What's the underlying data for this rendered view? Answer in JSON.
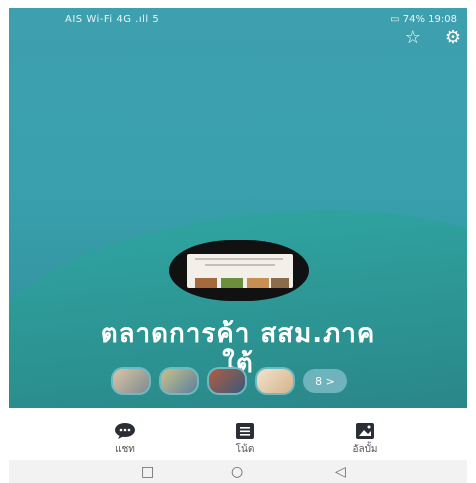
{
  "status": {
    "left": "AIS Wi-Fi 4G .ıll 5",
    "battery": "74%",
    "time": "19:08"
  },
  "actions": {
    "favorite_icon": "star-icon",
    "settings_icon": "gear-icon"
  },
  "group": {
    "title_line1": "ตลาดการค้า สสม.ภาค",
    "title_line2": "ใต้",
    "more_members_label": "8 >"
  },
  "tabs": [
    {
      "label": "แชท",
      "icon": "chat-bubble-icon"
    },
    {
      "label": "โน้ต",
      "icon": "note-icon"
    },
    {
      "label": "อัลบั้ม",
      "icon": "album-icon"
    }
  ],
  "colors": {
    "header_teal": "#3aa0ad",
    "wave_teal": "#2b8f8e",
    "tab_icon": "#2a2f36"
  }
}
